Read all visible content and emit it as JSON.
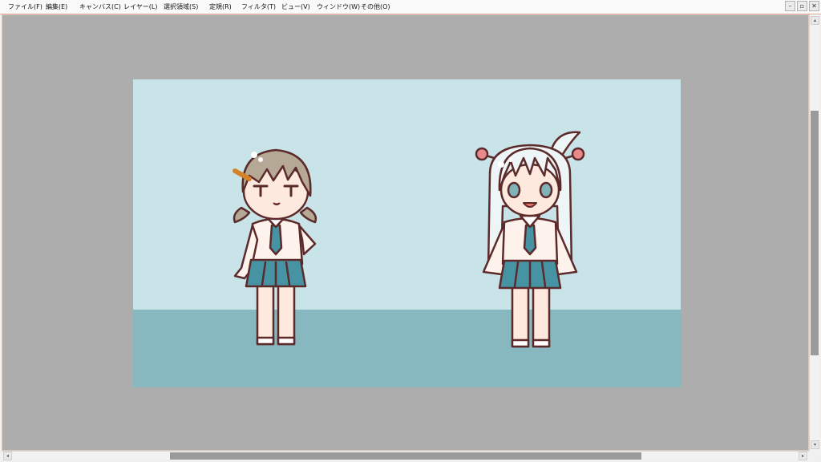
{
  "menu": {
    "file": "ファイル(F)",
    "edit": "編集(E)",
    "canvas": "キャンバス(C)",
    "layer": "レイヤー(L)",
    "selection": "選択領域(S)",
    "ruler": "定規(R)",
    "filter": "フィルタ(T)",
    "view": "ビュー(V)",
    "window": "ウィンドウ(W)",
    "other": "その他(O)"
  },
  "window_controls": {
    "minimize": "–",
    "restore": "▫",
    "close": "✕"
  },
  "scroll_arrows": {
    "up": "▴",
    "down": "▾",
    "left": "◂",
    "right": "▸"
  },
  "scroll": {
    "vertical_position": 0.23,
    "horizontal_position": 0.21
  },
  "colors": {
    "sky": "#c9e4e8",
    "floor": "#88b8bf",
    "workspace": "#adadad",
    "outline": "#5c2a2a",
    "skin": "#fde9dd",
    "skirt": "#4593a3",
    "hair_left": "#b5a996",
    "hair_right": "#eef5f6"
  }
}
